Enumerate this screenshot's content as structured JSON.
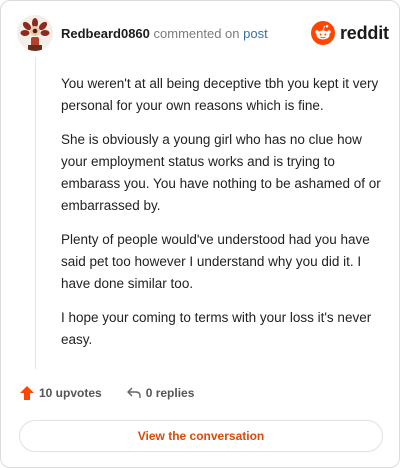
{
  "header": {
    "username": "Redbeard0860",
    "commented_text": "commented on",
    "post_link": "post",
    "brand": "reddit",
    "brand_color": "#ff4500"
  },
  "comment": {
    "paragraphs": [
      "You weren't at all being deceptive tbh you kept it very personal for your own reasons which is fine.",
      "She is obviously a young girl who has no clue how your employment status works and is trying to embarass you. You have nothing to be ashamed of or embarrassed by.",
      "Plenty of people would've understood had you have said pet too however I understand why you did it. I have done similar too.",
      "I hope your coming to terms with your loss it's never easy."
    ]
  },
  "actions": {
    "upvotes": "10 upvotes",
    "replies": "0 replies",
    "view_conversation": "View the conversation"
  },
  "icons": {
    "upvote": "upvote-arrow-icon",
    "reply": "reply-arrow-icon",
    "avatar": "avatar-icon",
    "logo": "reddit-logo-icon"
  },
  "colors": {
    "upvote": "#ff4500",
    "button_text": "#d84a0d",
    "link": "#3a6fa0"
  }
}
